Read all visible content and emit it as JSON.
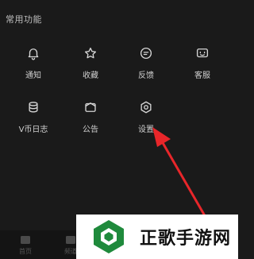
{
  "section": {
    "title": "常用功能"
  },
  "functions": [
    {
      "label": "通知",
      "icon": "bell-icon"
    },
    {
      "label": "收藏",
      "icon": "star-icon"
    },
    {
      "label": "反馈",
      "icon": "feedback-icon"
    },
    {
      "label": "客服",
      "icon": "customer-service-icon"
    },
    {
      "label": "V币日志",
      "icon": "coin-stack-icon"
    },
    {
      "label": "公告",
      "icon": "announcement-icon"
    },
    {
      "label": "设置",
      "icon": "gear-icon"
    }
  ],
  "bottom_nav": [
    {
      "label": "首页",
      "icon": "home-icon"
    },
    {
      "label": "频道",
      "icon": "channel-icon"
    }
  ],
  "watermark": {
    "text": "正歌手游网"
  },
  "colors": {
    "background": "#1a1a1a",
    "arrow": "#e8262a",
    "watermark_green": "#1f8a3c"
  }
}
